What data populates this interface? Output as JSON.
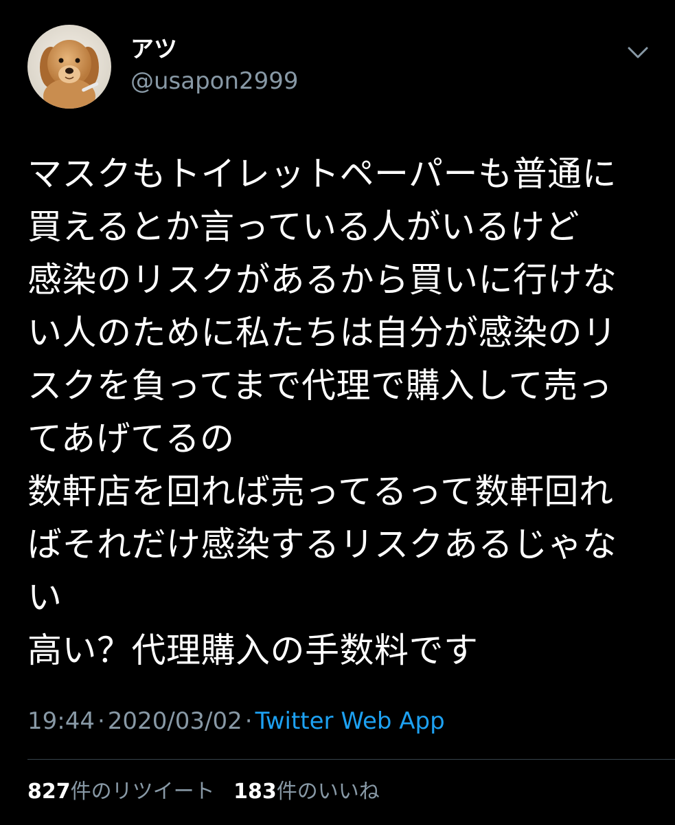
{
  "tweet": {
    "display_name": "アツ",
    "handle": "@usapon2999",
    "avatar_icon": "dog-avatar-icon",
    "menu_icon": "chevron-down-icon",
    "text_lines": [
      "マスクもトイレットペーパーも普通に",
      "買えるとか言っている人がいるけど",
      "感染のリスクがあるから買いに行けな",
      "い人のために私たちは自分が感染のリ",
      "スクを負ってまで代理で購入して売っ",
      "てあげてるの",
      "数軒店を回れば売ってるって数軒回れ",
      "ばそれだけ感染するリスクあるじゃな",
      "い",
      "高い？代理購入の手数料です"
    ],
    "time": "19:44",
    "date": "2020/03/02",
    "separator": "·",
    "source": "Twitter Web App"
  },
  "stats": {
    "retweet_count": "827",
    "retweet_label": "件のリツイート",
    "like_count": "183",
    "like_label": "件のいいね"
  },
  "colors": {
    "background": "#000000",
    "text": "#ffffff",
    "secondary_text": "#8899a6",
    "link": "#1da1f2",
    "divider": "#38444d"
  }
}
